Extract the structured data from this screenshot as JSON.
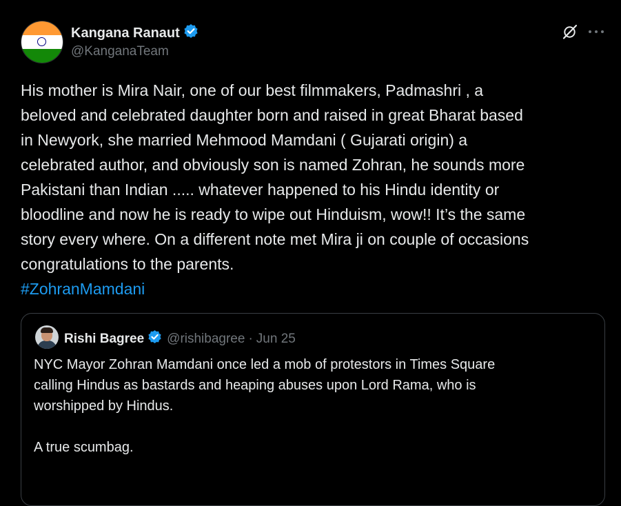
{
  "author": {
    "name": "Kangana Ranaut",
    "handle": "@KanganaTeam",
    "avatar": "india-flag",
    "verified": true,
    "verified_color": "#1d9bf0"
  },
  "actions": {
    "grok_icon": "grok-icon",
    "more_icon": "more-icon"
  },
  "tweet": {
    "lines": [
      "His mother is Mira Nair, one of our best filmmakers, Padmashri , a",
      "beloved and celebrated daughter born and raised in great Bharat based",
      "in Newyork, she married Mehmood Mamdani ( Gujarati origin) a",
      "celebrated author, and obviously son is named Zohran, he sounds more",
      "Pakistani than Indian ..... whatever happened to his Hindu identity or",
      "bloodline and now he is ready to wipe out Hinduism, wow!! It’s the same",
      "story every where. On a different note met Mira ji on couple of occasions",
      "congratulations to the parents."
    ],
    "hashtag": "#ZohranMamdani",
    "link_color": "#1d9bf0"
  },
  "quoted": {
    "name": "Rishi Bagree",
    "handle": "@rishibagree",
    "separator": "·",
    "date": "Jun 25",
    "verified": true,
    "lines": [
      "NYC Mayor Zohran Mamdani once led a mob of protestors in Times Square",
      "calling Hindus as bastards and heaping abuses upon Lord Rama, who is",
      "worshipped by Hindus."
    ],
    "closing": "A true scumbag."
  }
}
